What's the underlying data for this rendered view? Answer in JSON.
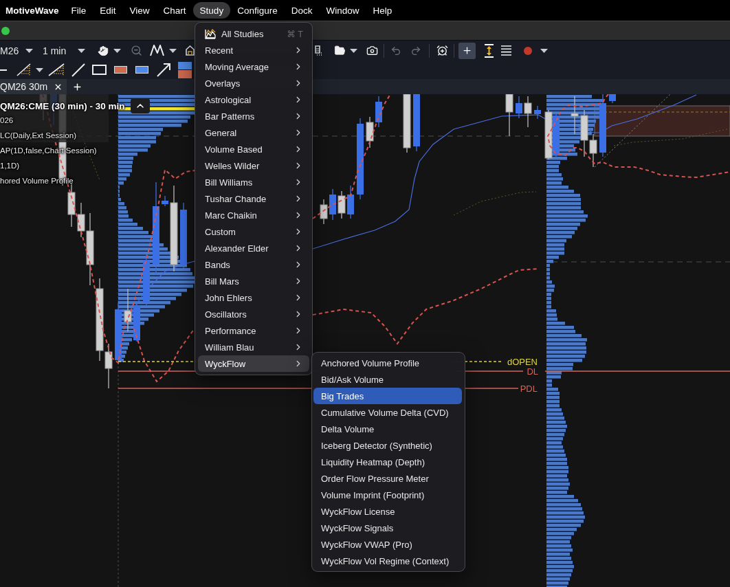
{
  "menu_bar": {
    "app_name": "MotiveWave",
    "menus": [
      {
        "label": "File",
        "selected": false
      },
      {
        "label": "Edit",
        "selected": false
      },
      {
        "label": "View",
        "selected": false
      },
      {
        "label": "Chart",
        "selected": false
      },
      {
        "label": "Study",
        "selected": true
      },
      {
        "label": "Configure",
        "selected": false
      },
      {
        "label": "Dock",
        "selected": false
      },
      {
        "label": "Window",
        "selected": false
      },
      {
        "label": "Help",
        "selected": false
      }
    ]
  },
  "toolbar": {
    "symbol": "M26",
    "interval": "1 min",
    "crosshair": {
      "selected": true
    }
  },
  "tabs": [
    {
      "label": "QM26 30m",
      "selected": true
    }
  ],
  "chart": {
    "title": "QM26:CME (30 min) - 30 min",
    "legend": [
      "026",
      "LC(Daily,Ext Session)",
      "AP(1D,false,Chart Session)",
      "1,1D)",
      "hored Volume Profile"
    ],
    "level_lines": [
      {
        "label": "dOPEN",
        "kind": "dashed",
        "color": "#ddd640"
      },
      {
        "label": "DL",
        "kind": "solid",
        "color": "#d4645a"
      },
      {
        "label": "PDL",
        "kind": "solid",
        "color": "#d4645a"
      }
    ]
  },
  "study_menu": {
    "items": [
      {
        "label": "All Studies",
        "kind": "command",
        "shortcut": "⌘ T",
        "selected": false
      },
      {
        "label": "Recent",
        "kind": "submenu",
        "selected": false
      },
      {
        "label": "Moving Average",
        "kind": "submenu",
        "selected": false
      },
      {
        "label": "Overlays",
        "kind": "submenu",
        "selected": false
      },
      {
        "label": "Astrological",
        "kind": "submenu",
        "selected": false
      },
      {
        "label": "Bar Patterns",
        "kind": "submenu",
        "selected": false
      },
      {
        "label": "General",
        "kind": "submenu",
        "selected": false
      },
      {
        "label": "Volume Based",
        "kind": "submenu",
        "selected": false
      },
      {
        "label": "Welles Wilder",
        "kind": "submenu",
        "selected": false
      },
      {
        "label": "Bill Williams",
        "kind": "submenu",
        "selected": false
      },
      {
        "label": "Tushar Chande",
        "kind": "submenu",
        "selected": false
      },
      {
        "label": "Marc Chaikin",
        "kind": "submenu",
        "selected": false
      },
      {
        "label": "Custom",
        "kind": "submenu",
        "selected": false
      },
      {
        "label": "Alexander Elder",
        "kind": "submenu",
        "selected": false
      },
      {
        "label": "Bands",
        "kind": "submenu",
        "selected": false
      },
      {
        "label": "Bill Mars",
        "kind": "submenu",
        "selected": false
      },
      {
        "label": "John Ehlers",
        "kind": "submenu",
        "selected": false
      },
      {
        "label": "Oscillators",
        "kind": "submenu",
        "selected": false
      },
      {
        "label": "Performance",
        "kind": "submenu",
        "selected": false
      },
      {
        "label": "William Blau",
        "kind": "submenu",
        "selected": false
      },
      {
        "label": "WyckFlow",
        "kind": "submenu",
        "selected": true
      }
    ]
  },
  "wyckflow_submenu": {
    "items": [
      {
        "label": "Anchored Volume Profile",
        "selected": false
      },
      {
        "label": "Bid/Ask Volume",
        "selected": false
      },
      {
        "label": "Big Trades",
        "selected": true
      },
      {
        "label": "Cumulative Volume Delta (CVD)",
        "selected": false
      },
      {
        "label": "Delta Volume",
        "selected": false
      },
      {
        "label": "Iceberg Detector (Synthetic)",
        "selected": false
      },
      {
        "label": "Liquidity Heatmap (Depth)",
        "selected": false
      },
      {
        "label": "Order Flow Pressure Meter",
        "selected": false
      },
      {
        "label": "Volume Imprint (Footprint)",
        "selected": false
      },
      {
        "label": "WyckFlow License",
        "selected": false
      },
      {
        "label": "WyckFlow Signals",
        "selected": false
      },
      {
        "label": "WyckFlow VWAP (Pro)",
        "selected": false
      },
      {
        "label": "WyckFlow Vol Regime (Context)",
        "selected": false
      }
    ]
  }
}
